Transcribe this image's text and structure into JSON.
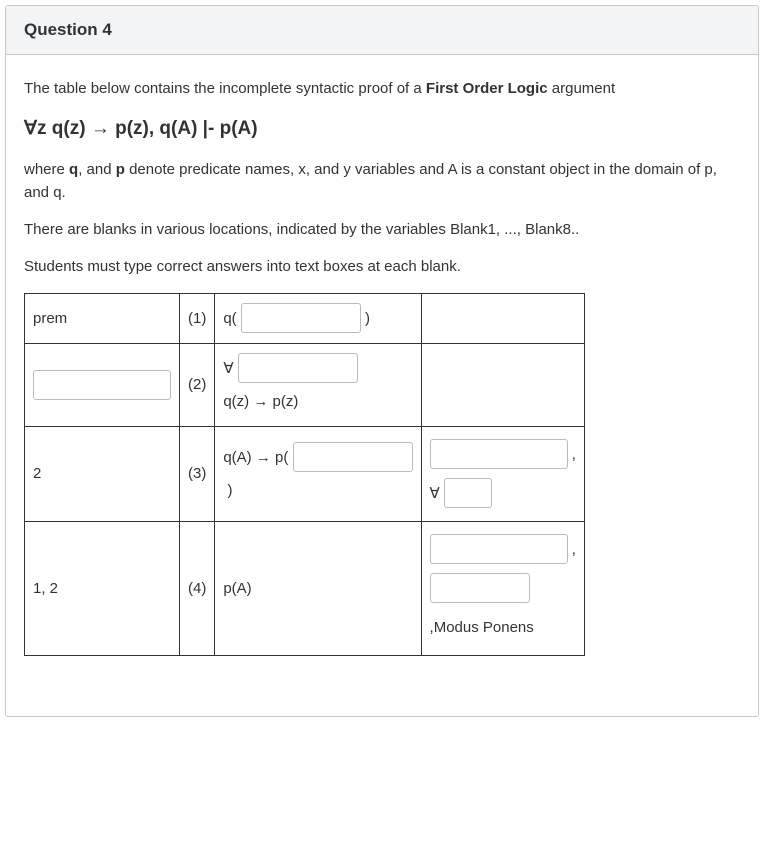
{
  "header": {
    "title": "Question 4"
  },
  "body": {
    "intro": "The table below contains the incomplete syntactic proof of a ",
    "intro_bold": "First Order Logic",
    "intro_tail": " argument",
    "formula": "∀z q(z) → p(z), q(A) |- p(A)",
    "desc1_pre": "where ",
    "desc1_q": "q",
    "desc1_mid1": ", and ",
    "desc1_p": "p",
    "desc1_tail": " denote predicate names, x, and y variables and A is a constant object in the domain of p, and q.",
    "desc2": "There are blanks in various locations,  indicated by the variables Blank1, ..., Blank8..",
    "desc3": "Students must type correct answers into text boxes at each blank."
  },
  "table": {
    "rows": [
      {
        "colA": "prem",
        "colB": "(1)",
        "colC_pre": "q( ",
        "colC_post": " )",
        "colD": ""
      },
      {
        "colA_input": "",
        "colB": "(2)",
        "colC_pre": "∀ ",
        "colC_post_line": "q(z) → p(z)",
        "colD": ""
      },
      {
        "colA": "2",
        "colB": "(3)",
        "colC_pre": "q(A) → p( ",
        "colC_post": " )",
        "colD_comma1": " ,",
        "colD_forall": "∀ "
      },
      {
        "colA": "1, 2",
        "colB": "(4)",
        "colC": "p(A)",
        "colD_comma1": " ,",
        "colD_tail": ",Modus Ponens"
      }
    ]
  }
}
